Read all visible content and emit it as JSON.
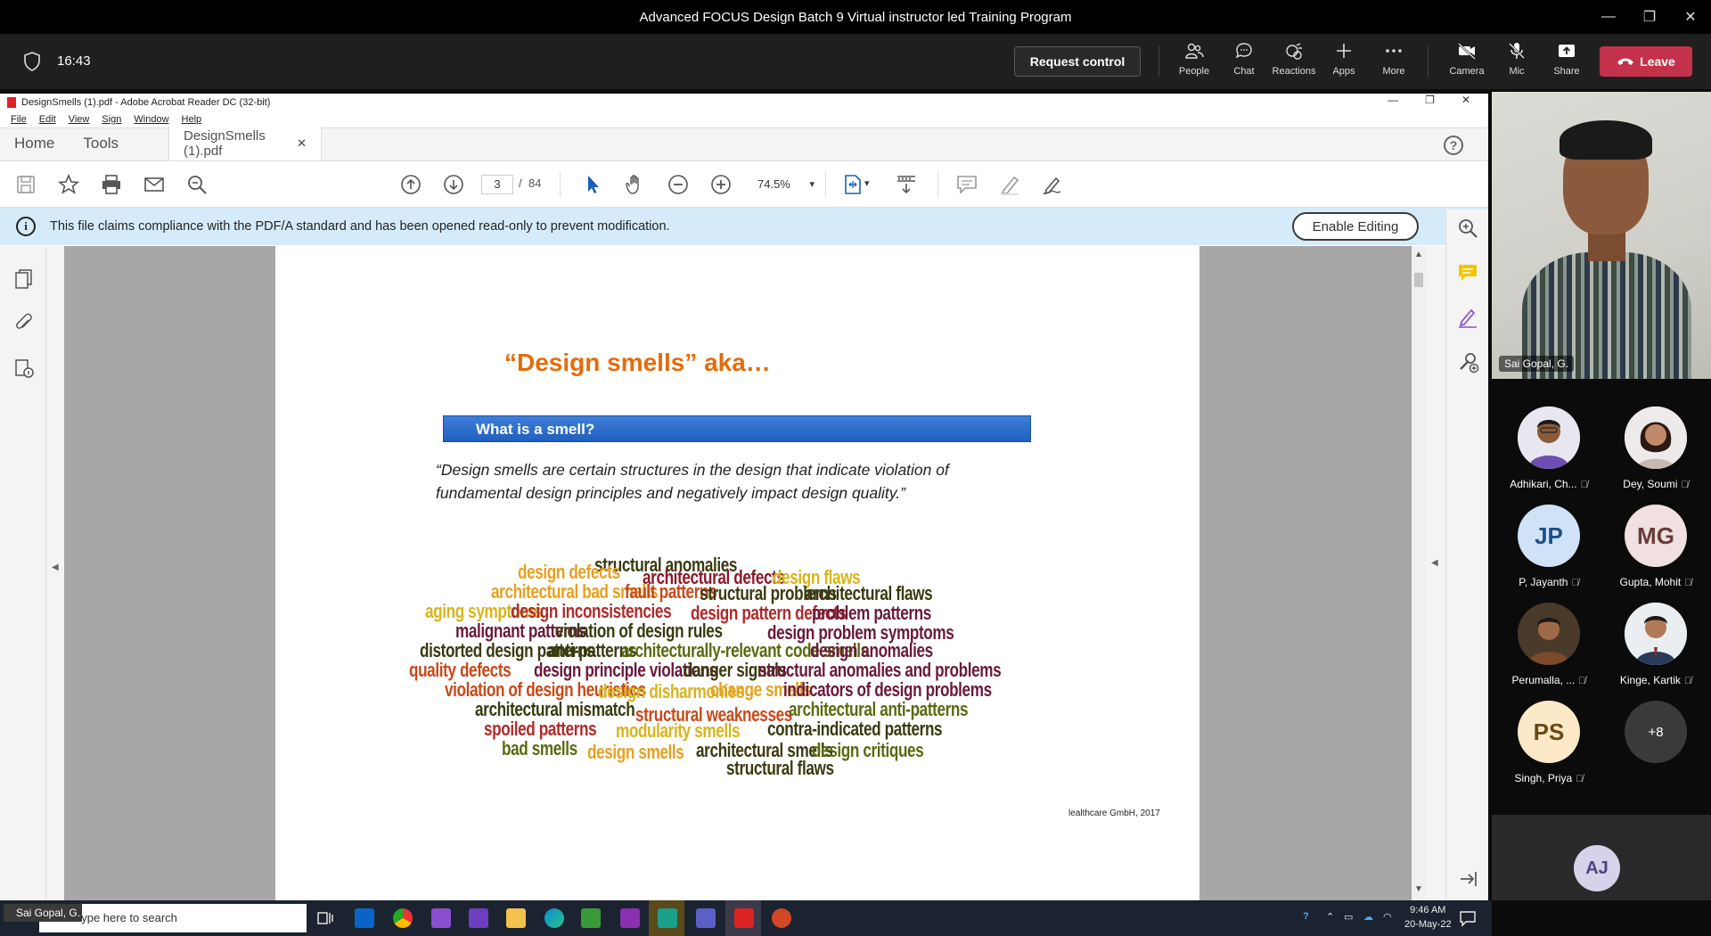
{
  "meeting": {
    "title": "Advanced FOCUS Design Batch 9 Virtual instructor led Training Program",
    "time": "16:43",
    "request_control": "Request control",
    "buttons": {
      "people": "People",
      "chat": "Chat",
      "reactions": "Reactions",
      "apps": "Apps",
      "more": "More",
      "camera": "Camera",
      "mic": "Mic",
      "share": "Share"
    },
    "leave": "Leave"
  },
  "acrobat": {
    "window_title": "DesignSmells (1).pdf - Adobe Acrobat Reader DC (32-bit)",
    "menu": [
      "File",
      "Edit",
      "View",
      "Sign",
      "Window",
      "Help"
    ],
    "tabs": {
      "home": "Home",
      "tools": "Tools",
      "doc": "DesignSmells (1).pdf"
    },
    "page_current": "3",
    "page_sep": "/",
    "page_total": "84",
    "zoom": "74.5%",
    "info_message": "This file claims compliance with the PDF/A standard and has been opened read-only to prevent modification.",
    "enable_editing": "Enable Editing"
  },
  "slide": {
    "title": "“Design smells” aka…",
    "bar_heading": "What is a smell?",
    "quote_line1": "“Design smells are certain structures in the design that indicate violation of",
    "quote_line2": "fundamental design principles and negatively impact design quality.”",
    "credit": "lealthcare GmbH, 2017",
    "wordcloud": [
      "structural anomalies",
      "design defects",
      "architectural defects",
      "design flaws",
      "architectural bad smells",
      "fault patterns",
      "structural problems",
      "architectural flaws",
      "aging symptoms",
      "design inconsistencies",
      "design pattern defects",
      "problem patterns",
      "malignant patterns",
      "violation of design rules",
      "design problem symptoms",
      "distorted design patterns",
      "anti-patterns",
      "architecturally-relevant code smells",
      "design anomalies",
      "quality defects",
      "design principle violations",
      "danger signals",
      "structural anomalies and problems",
      "violation of design heuristics",
      "design disharmonies",
      "change smells",
      "indicators of design problems",
      "architectural mismatch",
      "structural weaknesses",
      "architectural anti-patterns",
      "spoiled patterns",
      "modularity smells",
      "contra-indicated patterns",
      "bad smells",
      "design smells",
      "architectural smells",
      "design critiques",
      "structural flaws"
    ]
  },
  "presenter": {
    "name": "Sai Gopal, G."
  },
  "participants": [
    {
      "name": "Adhikari, Ch...",
      "initials": ""
    },
    {
      "name": "Dey, Soumi",
      "initials": ""
    },
    {
      "name": "P, Jayanth",
      "initials": "JP"
    },
    {
      "name": "Gupta, Mohit",
      "initials": "MG"
    },
    {
      "name": "Perumalla, ...",
      "initials": ""
    },
    {
      "name": "Kinge, Kartik",
      "initials": ""
    },
    {
      "name": "Singh, Priya",
      "initials": "PS"
    },
    {
      "name": "",
      "initials": "+8"
    }
  ],
  "self_tile": {
    "initials": "AJ"
  },
  "taskbar": {
    "self_label": "Sai Gopal, G.",
    "search_placeholder": "Type here to search",
    "time": "9:46 AM",
    "date": "20-May-22"
  },
  "colors": {
    "leave": "#c4314b",
    "slide_title": "#e46c0a",
    "info_bar": "#d6ebf9",
    "bar_blue": "#2a6ccf"
  }
}
